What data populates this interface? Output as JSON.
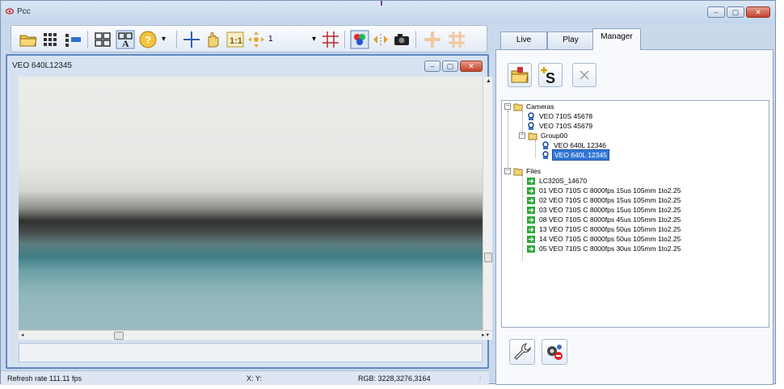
{
  "window": {
    "title": "Pcc",
    "minimize": "–",
    "maximize": "▢",
    "close": "✕"
  },
  "toolbar": {
    "icons": [
      "open-folder-icon",
      "grid-icon",
      "layout-icon",
      "tile-icon",
      "auto-icon",
      "help-icon",
      "crosshair-icon",
      "hand-icon",
      "one-to-one-icon",
      "zoom-icon",
      "grid-overlay-icon",
      "color-icon",
      "flip-icon",
      "camera-icon",
      "cross-disabled-icon",
      "grid-disabled-icon"
    ],
    "zoom_level": "1",
    "dropdown_arrow": "▾"
  },
  "viewer": {
    "title": "VEO 640L12345",
    "minimize": "–",
    "maximize": "▢",
    "close": "✕",
    "scroll_up": "▲",
    "scroll_left": "◂",
    "scroll_right": "▸ ▾"
  },
  "status": {
    "refresh": "Refresh rate 111.11 fps",
    "xy": "X: Y:",
    "rgb": "RGB: 3228,3276,3164",
    "grip": "⁞"
  },
  "tabs": [
    {
      "label": "Live"
    },
    {
      "label": "Play"
    },
    {
      "label": "Manager"
    }
  ],
  "manager": {
    "buttons": [
      "new-folder-icon",
      "add-camera-icon",
      "delete-icon"
    ],
    "delete_label": "✕",
    "tree": {
      "cameras_label": "Cameras",
      "camera1": "VEO 710S 45678",
      "camera2": "VEO 710S 45679",
      "group_label": "Group00",
      "group_cam1": "VEO 640L 12346",
      "group_cam2": "VEO 640L 12345",
      "files_label": "Files",
      "files": [
        "LC320S_14670",
        "01  VEO 710S C 8000fps 15us 105mm 1to2.25",
        "02  VEO 710S C 8000fps 15us 105mm 1to2.25",
        "03  VEO 710S C 8000fps 15us 105mm 1to2.25",
        "08 VEO 710S C 8000fps 45us 105mm 1to2.25",
        "13 VEO 710S C 8000fps 50us 105mm 1to2.25",
        "14 VEO 710S C 8000fps 50us 105mm 1to2.25",
        "05  VEO 710S C 8000fps 30us 105mm 1to2.25"
      ],
      "expander_minus": "−"
    },
    "footer_buttons": [
      "wrench-icon",
      "network-settings-icon"
    ]
  }
}
